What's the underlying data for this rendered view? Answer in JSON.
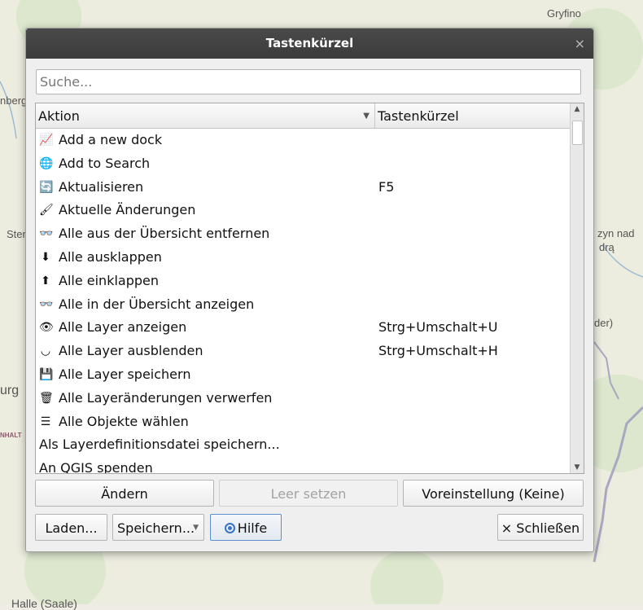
{
  "map": {
    "labels": [
      "Gryfino",
      "nberg",
      "Stern",
      "zyn nad",
      "drą",
      "der)",
      "urg",
      "NHALT",
      "Halle (Saale)"
    ]
  },
  "dialog": {
    "title": "Tastenkürzel",
    "close_glyph": "×",
    "search_placeholder": "Suche...",
    "columns": [
      "Aktion",
      "Tastenkürzel"
    ],
    "rows": [
      {
        "icon": "chart-line-icon",
        "glyph": "📈",
        "label": "Add a new dock",
        "shortcut": ""
      },
      {
        "icon": "globe-search-icon",
        "glyph": "🌐",
        "label": "Add to Search",
        "shortcut": ""
      },
      {
        "icon": "refresh-icon",
        "glyph": "🔄",
        "label": "Aktualisieren",
        "shortcut": "F5"
      },
      {
        "icon": "brush-icon",
        "glyph": "🖌",
        "label": "Aktuelle Änderungen",
        "shortcut": ""
      },
      {
        "icon": "glasses-remove-icon",
        "glyph": "👓",
        "label": "Alle aus der Übersicht entfernen",
        "shortcut": ""
      },
      {
        "icon": "expand-down-icon",
        "glyph": "⬇",
        "label": "Alle ausklappen",
        "shortcut": ""
      },
      {
        "icon": "collapse-up-icon",
        "glyph": "⬆",
        "label": "Alle einklappen",
        "shortcut": ""
      },
      {
        "icon": "glasses-icon",
        "glyph": "👓",
        "label": "Alle in der Übersicht anzeigen",
        "shortcut": ""
      },
      {
        "icon": "eye-icon",
        "glyph": "👁",
        "label": "Alle Layer anzeigen",
        "shortcut": "Strg+Umschalt+U"
      },
      {
        "icon": "eye-closed-icon",
        "glyph": "◡",
        "label": "Alle Layer ausblenden",
        "shortcut": "Strg+Umschalt+H"
      },
      {
        "icon": "save-layer-icon",
        "glyph": "💾",
        "label": "Alle Layer speichern",
        "shortcut": ""
      },
      {
        "icon": "discard-edits-icon",
        "glyph": "🗑",
        "label": "Alle Layeränderungen verwerfen",
        "shortcut": ""
      },
      {
        "icon": "select-all-icon",
        "glyph": "☰",
        "label": "Alle Objekte wählen",
        "shortcut": ""
      },
      {
        "icon": "",
        "glyph": "",
        "label": "Als Layerdefinitionsdatei speichern...",
        "shortcut": ""
      },
      {
        "icon": "",
        "glyph": "",
        "label": "An QGIS spenden",
        "shortcut": ""
      }
    ],
    "buttons": {
      "change": "Ändern",
      "clear": "Leer setzen",
      "default": "Voreinstellung (Keine)",
      "load": "Laden...",
      "save": "Speichern...",
      "help": "Hilfe",
      "close": "Schließen",
      "close_glyph": "×"
    }
  }
}
